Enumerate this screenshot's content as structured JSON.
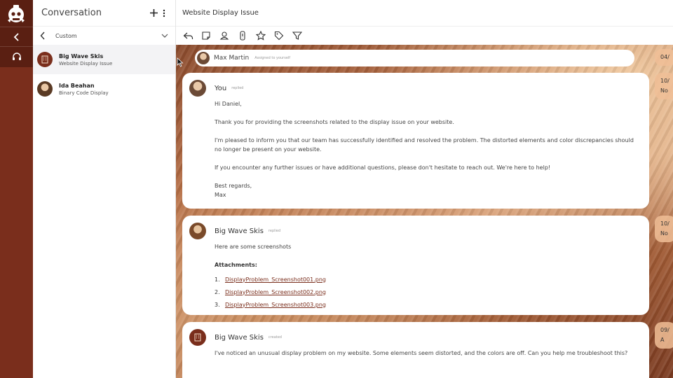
{
  "rail": {
    "logo_icon": "mascot-logo",
    "back_icon": "chevron-left-icon",
    "agent_icon": "headset-icon",
    "colors": {
      "rail": "#7a2e1c",
      "rail_top": "#5a1f12"
    }
  },
  "list": {
    "title": "Conversation",
    "add_icon": "plus-icon",
    "menu_icon": "more-vertical-icon",
    "filter": {
      "label": "Custom"
    },
    "items": [
      {
        "name": "Big Wave Skis",
        "subject": "Website Display Issue",
        "active": true
      },
      {
        "name": "Ida Beahan",
        "subject": "Binary Code Display",
        "active": false
      }
    ]
  },
  "main": {
    "title": "Website Display Issue",
    "toolbar": [
      "reply-icon",
      "note-icon",
      "assign-icon",
      "priority-icon",
      "star-icon",
      "tag-icon",
      "filter-icon"
    ],
    "assigned": {
      "name": "Max Martin",
      "note": "Assigned to yourself"
    },
    "messages": [
      {
        "author": "You",
        "action": "replied",
        "body": [
          "Hi Daniel,",
          "Thank you for providing the screenshots related to the display issue on your website.",
          "I'm pleased to inform you that our team has successfully identified and resolved the problem. The distorted elements and color discrepancies should no longer be present on your website.",
          "If you encounter any further issues or have additional questions, please don't hesitate to reach out. We're here to help!",
          "Best regards,",
          "Max"
        ]
      },
      {
        "author": "Big Wave Skis",
        "action": "replied",
        "body": [
          "Here are some screenshots"
        ],
        "attachments_title": "Attachments:",
        "attachments": [
          "DisplayProblem_Screenshot001.png",
          "DisplayProblem_Screenshot002.png",
          "DisplayProblem_Screenshot003.png"
        ]
      },
      {
        "author": "Big Wave Skis",
        "action": "created",
        "body": [
          "I've noticed an unusual display problem on my website. Some elements seem distorted, and the colors are off. Can you help me troubleshoot this?"
        ]
      }
    ],
    "date_pills": [
      {
        "line1": "04/",
        "line2": ""
      },
      {
        "line1": "10/",
        "line2": "No"
      },
      {
        "line1": "10/",
        "line2": "No"
      },
      {
        "line1": "09/",
        "line2": "A"
      }
    ]
  }
}
